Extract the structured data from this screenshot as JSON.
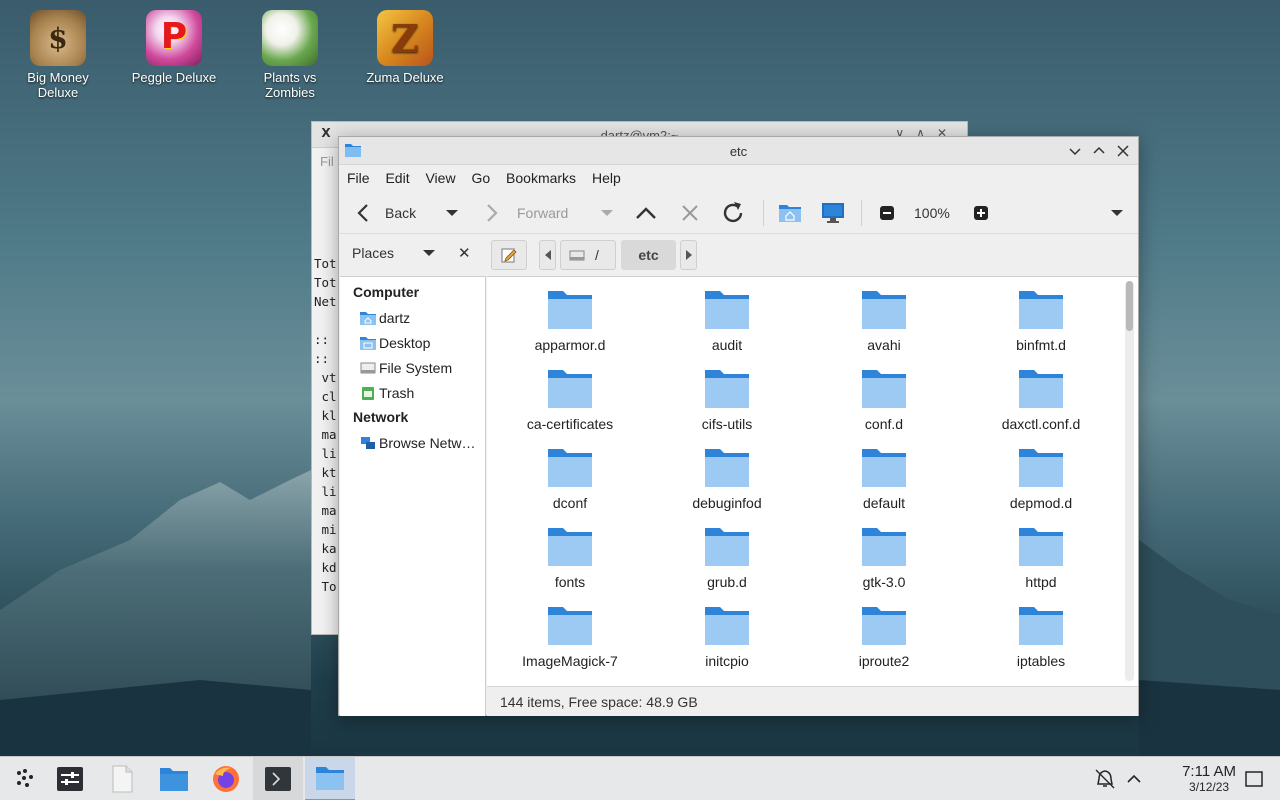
{
  "desktop": {
    "icons": [
      {
        "label_line1": "Big Money",
        "label_line2": "Deluxe"
      },
      {
        "label_line1": "Peggle Deluxe",
        "label_line2": ""
      },
      {
        "label_line1": "Plants vs",
        "label_line2": "Zombies"
      },
      {
        "label_line1": "Zuma Deluxe",
        "label_line2": ""
      }
    ]
  },
  "terminal": {
    "title": "dartz@vm2:~",
    "menu_fragment": "Fil",
    "lines": [
      "",
      "",
      "",
      "",
      "Tot",
      "Tot",
      "Net",
      "",
      "::",
      "::",
      " vt",
      " cl",
      " kl",
      " ma",
      " li",
      " kt",
      " li",
      " ma",
      " mi",
      " ka",
      " kd",
      " To"
    ]
  },
  "file_manager": {
    "title": "etc",
    "menu": [
      "File",
      "Edit",
      "View",
      "Go",
      "Bookmarks",
      "Help"
    ],
    "toolbar": {
      "back": "Back",
      "forward": "Forward",
      "zoom": "100%"
    },
    "places": {
      "label": "Places",
      "sections": [
        {
          "heading": "Computer",
          "items": [
            "dartz",
            "Desktop",
            "File System",
            "Trash"
          ]
        },
        {
          "heading": "Network",
          "items": [
            "Browse Netw…"
          ]
        }
      ]
    },
    "path": {
      "root": "/",
      "current": "etc"
    },
    "items": [
      "apparmor.d",
      "audit",
      "avahi",
      "binfmt.d",
      "ca-certificates",
      "cifs-utils",
      "conf.d",
      "daxctl.conf.d",
      "dconf",
      "debuginfod",
      "default",
      "depmod.d",
      "fonts",
      "grub.d",
      "gtk-3.0",
      "httpd",
      "ImageMagick-7",
      "initcpio",
      "iproute2",
      "iptables"
    ],
    "status": "144 items, Free space: 48.9 GB"
  },
  "taskbar": {
    "time": "7:11 AM",
    "date": "3/12/23"
  },
  "colors": {
    "folder_dark": "#2d84d8",
    "folder_light": "#9dcaf3",
    "accent": "#3daee9"
  }
}
